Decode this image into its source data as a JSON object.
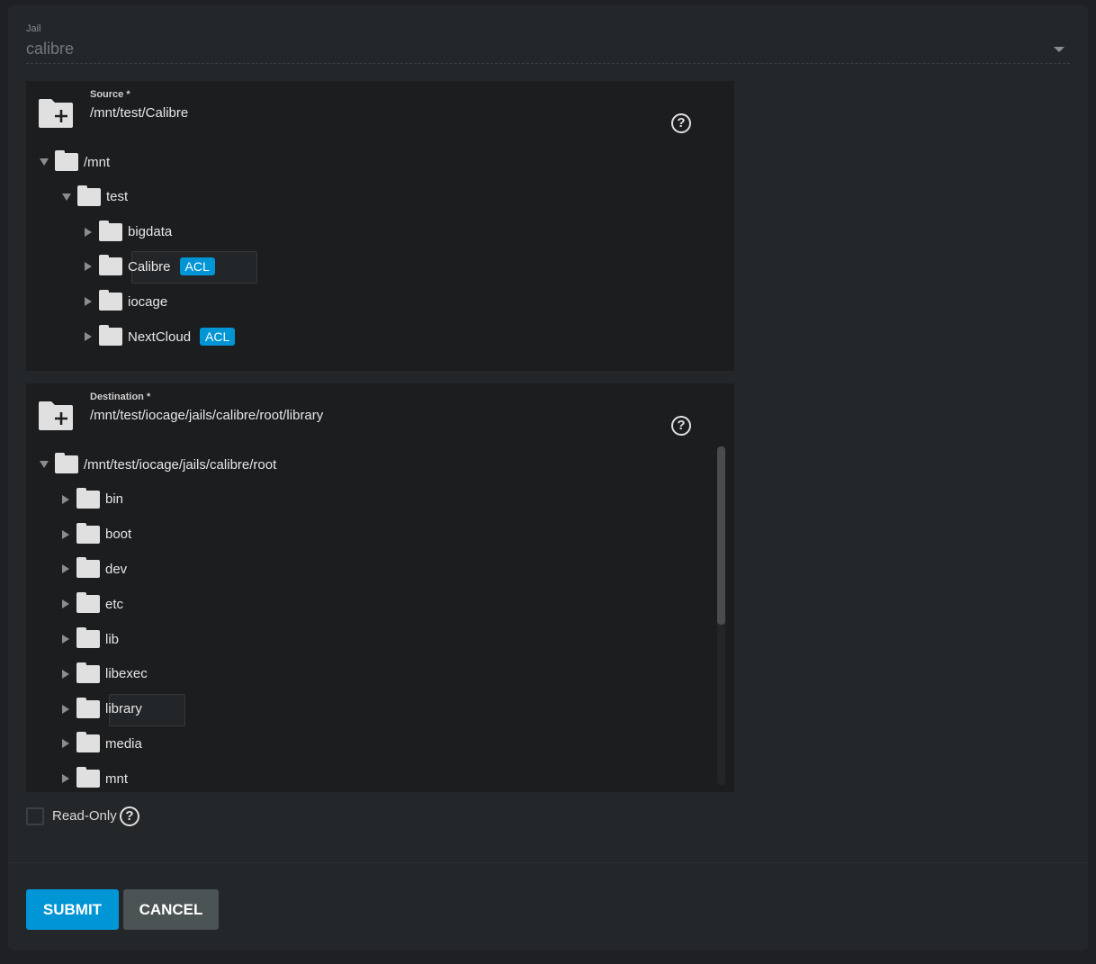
{
  "jail": {
    "label": "Jail",
    "value": "calibre"
  },
  "source": {
    "label": "Source *",
    "value": "/mnt/test/Calibre",
    "tree": [
      {
        "name": "/mnt",
        "level": 0,
        "expanded": true
      },
      {
        "name": "test",
        "level": 1,
        "expanded": true
      },
      {
        "name": "bigdata",
        "level": 2
      },
      {
        "name": "Calibre",
        "level": 2,
        "acl": "ACL",
        "selected": true
      },
      {
        "name": "iocage",
        "level": 2
      },
      {
        "name": "NextCloud",
        "level": 2,
        "acl": "ACL"
      }
    ]
  },
  "destination": {
    "label": "Destination *",
    "value": "/mnt/test/iocage/jails/calibre/root/library",
    "tree": [
      {
        "name": "/mnt/test/iocage/jails/calibre/root",
        "level": 0,
        "expanded": true
      },
      {
        "name": "bin",
        "level": 1
      },
      {
        "name": "boot",
        "level": 1
      },
      {
        "name": "dev",
        "level": 1
      },
      {
        "name": "etc",
        "level": 1
      },
      {
        "name": "lib",
        "level": 1
      },
      {
        "name": "libexec",
        "level": 1
      },
      {
        "name": "library",
        "level": 1,
        "selected": true
      },
      {
        "name": "media",
        "level": 1
      },
      {
        "name": "mnt",
        "level": 1
      }
    ]
  },
  "read_only": {
    "label": "Read-Only",
    "checked": false
  },
  "buttons": {
    "submit": "SUBMIT",
    "cancel": "CANCEL"
  },
  "colors": {
    "accent": "#0095d5",
    "panel": "#1c1d1f",
    "card": "#242729"
  }
}
